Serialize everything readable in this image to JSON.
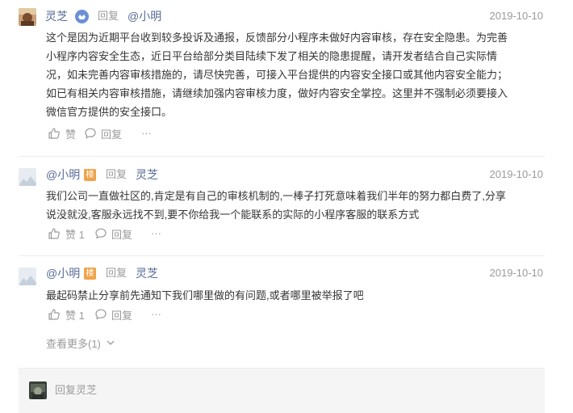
{
  "comment": {
    "author": "灵芝",
    "reply_label": "回复",
    "reply_to": "@小明",
    "date": "2019-10-10",
    "text_lines": [
      "这个是因为近期平台收到较多投诉及通报，反馈部分小程序未做好内容审核，存在安全隐患。为完善",
      "小程序内容安全生态，近日平台给部分类目陆续下发了相关的隐患提醒，请开发者结合自己实际情",
      "况，如未完善内容审核措施的，请尽快完善，可接入平台提供的内容安全接口或其他内容安全能力；",
      "如已有相关内容审核措施，请继续加强内容审核力度，做好内容安全掌控。这里并不强制必须要接入",
      "微信官方提供的安全接口。"
    ],
    "like_label": "赞",
    "reply_action": "回复",
    "more": "···"
  },
  "replies": [
    {
      "author": "@小明",
      "badge": "楼",
      "reply_label": "回复",
      "reply_to": "灵芝",
      "date": "2019-10-10",
      "text_lines": [
        "我们公司一直做社区的,肯定是有自己的审核机制的,一棒子打死意味着我们半年的努力都白费了,分享",
        "说没就没,客服永远找不到,要不你给我一个能联系的实际的小程序客服的联系方式"
      ],
      "like_label": "赞 1",
      "reply_action": "回复",
      "more": "···"
    },
    {
      "author": "@小明",
      "badge": "楼",
      "reply_label": "回复",
      "reply_to": "灵芝",
      "date": "2019-10-10",
      "text_lines": [
        "最起码禁止分享前先通知下我们哪里做的有问题,或者哪里被举报了吧"
      ],
      "like_label": "赞 1",
      "reply_action": "回复",
      "more": "···"
    }
  ],
  "view_more": "查看更多(1)",
  "reply_box": {
    "placeholder": "回复灵芝"
  },
  "colors": {
    "link": "#576b95",
    "muted": "#9a9a9a",
    "badge": "#f0a44a"
  }
}
